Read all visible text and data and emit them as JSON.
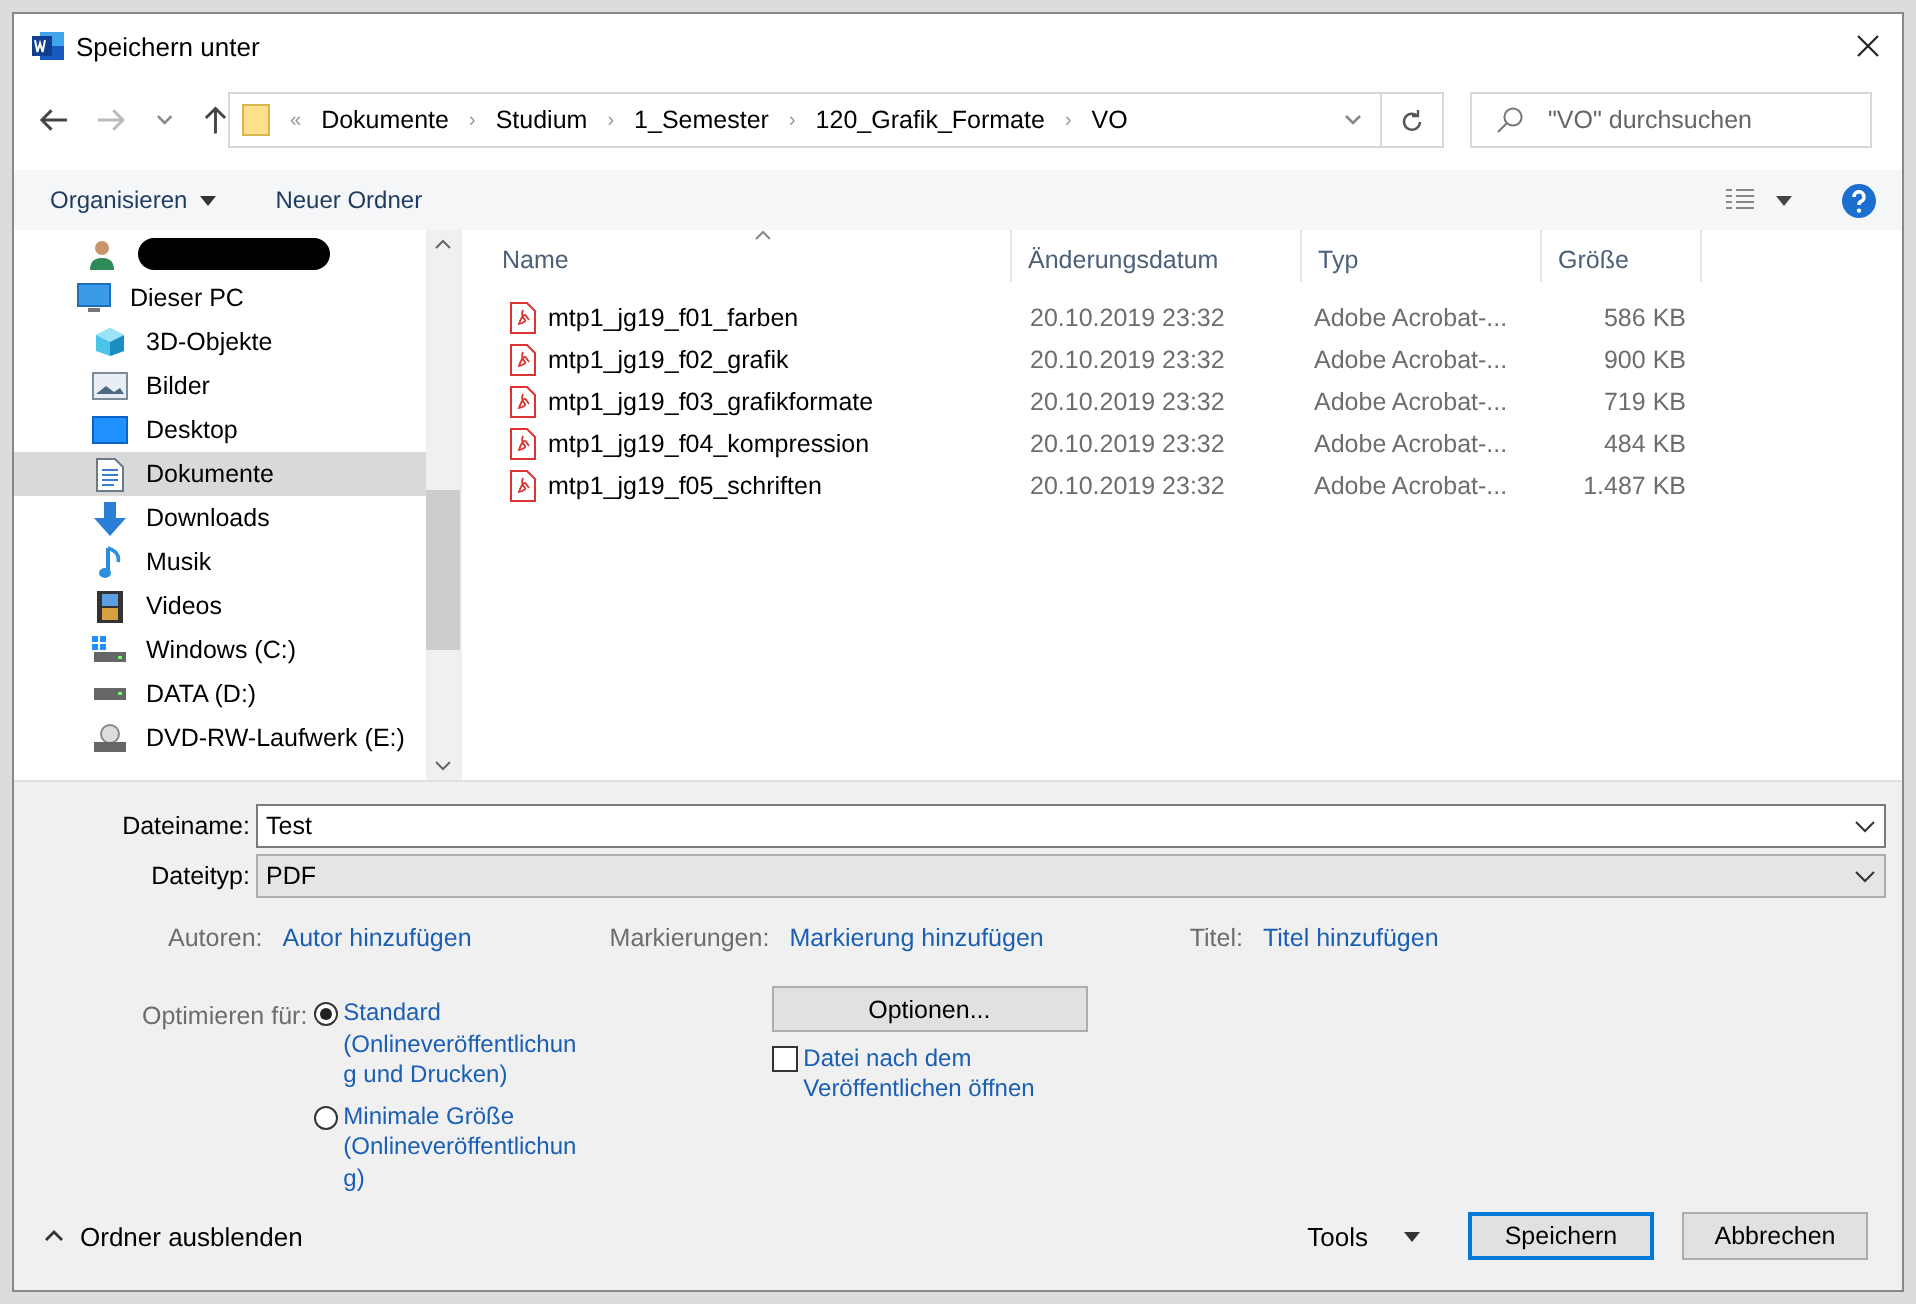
{
  "window": {
    "title": "Speichern unter"
  },
  "address": {
    "overflow": "«",
    "separator": "›",
    "segments": [
      "Dokumente",
      "Studium",
      "1_Semester",
      "120_Grafik_Formate",
      "VO"
    ]
  },
  "search": {
    "placeholder": "\"VO\" durchsuchen"
  },
  "toolbar": {
    "organize": "Organisieren",
    "new_folder": "Neuer Ordner"
  },
  "sidebar": {
    "items": [
      {
        "kind": "user",
        "redacted": true,
        "selected": false
      },
      {
        "kind": "pc",
        "label": "Dieser PC",
        "selected": false,
        "children": [
          {
            "kind": "objects3d",
            "label": "3D-Objekte",
            "selected": false
          },
          {
            "kind": "pictures",
            "label": "Bilder",
            "selected": false
          },
          {
            "kind": "desktop",
            "label": "Desktop",
            "selected": false
          },
          {
            "kind": "documents",
            "label": "Dokumente",
            "selected": true
          },
          {
            "kind": "downloads",
            "label": "Downloads",
            "selected": false
          },
          {
            "kind": "music",
            "label": "Musik",
            "selected": false
          },
          {
            "kind": "videos",
            "label": "Videos",
            "selected": false
          },
          {
            "kind": "system-drive",
            "label": "Windows (C:)",
            "selected": false
          },
          {
            "kind": "drive",
            "label": "DATA (D:)",
            "selected": false
          },
          {
            "kind": "optical-drive",
            "label": "DVD-RW-Laufwerk (E:)",
            "selected": false
          }
        ]
      }
    ]
  },
  "table": {
    "columns": [
      "Name",
      "Änderungsdatum",
      "Typ",
      "Größe"
    ],
    "rows": [
      {
        "name": "mtp1_jg19_f01_farben",
        "date": "20.10.2019 23:32",
        "type": "Adobe Acrobat-...",
        "size": "586 KB"
      },
      {
        "name": "mtp1_jg19_f02_grafik",
        "date": "20.10.2019 23:32",
        "type": "Adobe Acrobat-...",
        "size": "900 KB"
      },
      {
        "name": "mtp1_jg19_f03_grafikformate",
        "date": "20.10.2019 23:32",
        "type": "Adobe Acrobat-...",
        "size": "719 KB"
      },
      {
        "name": "mtp1_jg19_f04_kompression",
        "date": "20.10.2019 23:32",
        "type": "Adobe Acrobat-...",
        "size": "484 KB"
      },
      {
        "name": "mtp1_jg19_f05_schriften",
        "date": "20.10.2019 23:32",
        "type": "Adobe Acrobat-...",
        "size": "1.487 KB"
      }
    ]
  },
  "form": {
    "filename": {
      "label": "Dateiname:",
      "value": "Test"
    },
    "filetype": {
      "label": "Dateityp:",
      "value": "PDF"
    },
    "metadata": [
      {
        "label": "Autoren:",
        "link": "Autor hinzufügen"
      },
      {
        "label": "Markierungen:",
        "link": "Markierung hinzufügen"
      },
      {
        "label": "Titel:",
        "link": "Titel hinzufügen"
      }
    ],
    "optimize": {
      "label": "Optimieren für:",
      "options": [
        {
          "title": "Standard",
          "detail": "(Onlineveröffentlichung und Drucken)",
          "selected": true
        },
        {
          "title": "Minimale Größe",
          "detail": "(Onlineveröffentlichung)",
          "selected": false
        }
      ]
    },
    "options_button": "Optionen...",
    "open_after": {
      "label": "Datei nach dem Veröffentlichen öffnen",
      "checked": false
    }
  },
  "footer": {
    "toggle": "Ordner ausblenden",
    "tools": "Tools",
    "save": "Speichern",
    "cancel": "Abbrechen"
  }
}
